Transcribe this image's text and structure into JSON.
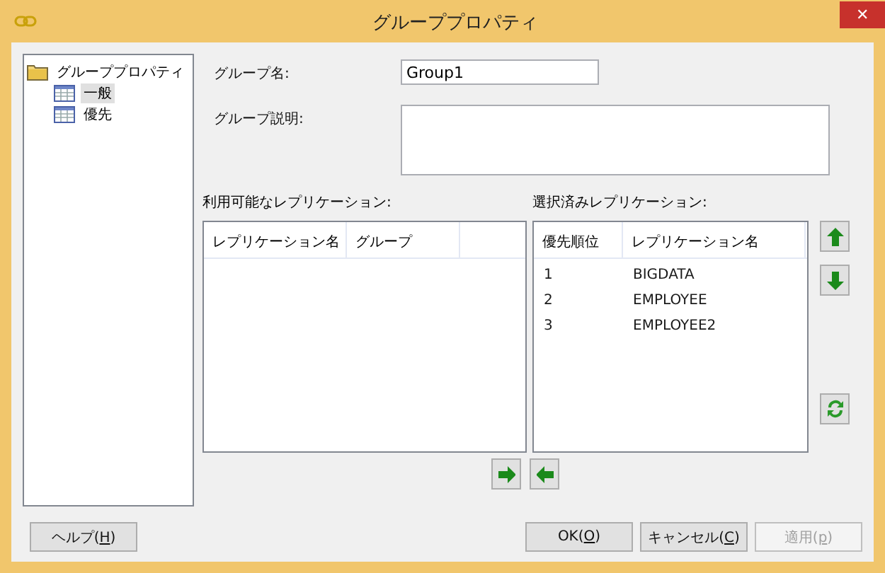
{
  "window": {
    "title": "グループプロパティ",
    "close": "✕"
  },
  "tree": {
    "label": "グループプロパティ",
    "children": [
      {
        "label": "一般",
        "selected": true
      },
      {
        "label": "優先",
        "selected": false
      }
    ]
  },
  "form": {
    "name_label": "グループ名:",
    "name_value": "Group1",
    "description_label": "グループ説明:"
  },
  "available": {
    "label": "利用可能なレプリケーション:",
    "columns": [
      "レプリケーション名",
      "グループ"
    ]
  },
  "selected_list": {
    "label": "選択済みレプリケーション:",
    "columns": [
      "優先順位",
      "レプリケーション名"
    ],
    "rows": [
      {
        "priority": "1",
        "name": "BIGDATA"
      },
      {
        "priority": "2",
        "name": "EMPLOYEE"
      },
      {
        "priority": "3",
        "name": "EMPLOYEE2"
      }
    ]
  },
  "buttons": [
    {
      "parts": [
        "ヘルプ(",
        "H",
        ")"
      ],
      "disabled": false
    },
    {
      "parts": [
        "OK(",
        "O",
        ")"
      ],
      "disabled": false
    },
    {
      "parts": [
        "キャンセル(",
        "C",
        ")"
      ],
      "disabled": false
    },
    {
      "parts": [
        "適用(",
        "p",
        ")"
      ],
      "disabled": true
    }
  ]
}
